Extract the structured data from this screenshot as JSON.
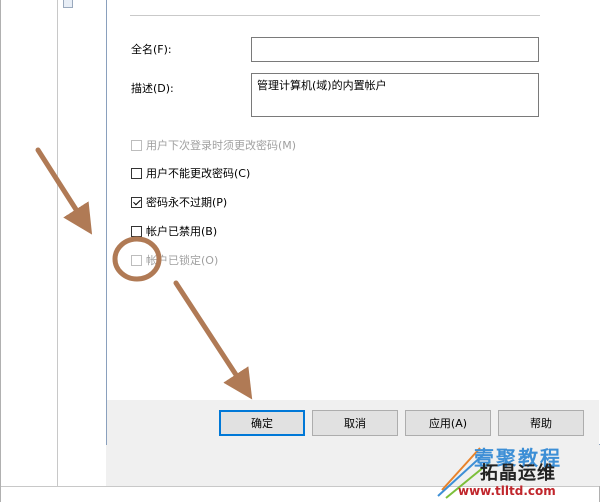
{
  "fields": {
    "full_name_label": "全名(F):",
    "full_name_value": "",
    "description_label": "描述(D):",
    "description_value": "管理计算机(域)的内置帐户"
  },
  "checkboxes": [
    {
      "label": "用户下次登录时须更改密码(M)",
      "checked": false,
      "enabled": false
    },
    {
      "label": "用户不能更改密码(C)",
      "checked": false,
      "enabled": true
    },
    {
      "label": "密码永不过期(P)",
      "checked": true,
      "enabled": true
    },
    {
      "label": "帐户已禁用(B)",
      "checked": false,
      "enabled": true
    },
    {
      "label": "帐户已锁定(O)",
      "checked": false,
      "enabled": false
    }
  ],
  "buttons": {
    "ok": "确定",
    "cancel": "取消",
    "apply": "应用(A)",
    "help": "帮助"
  },
  "watermark": {
    "line1": "壹聚教程",
    "line2": "拓晶运维",
    "url": "www.tlltd.com"
  },
  "colors": {
    "annotation": "#b07a55",
    "default_button_border": "#0078d7"
  }
}
